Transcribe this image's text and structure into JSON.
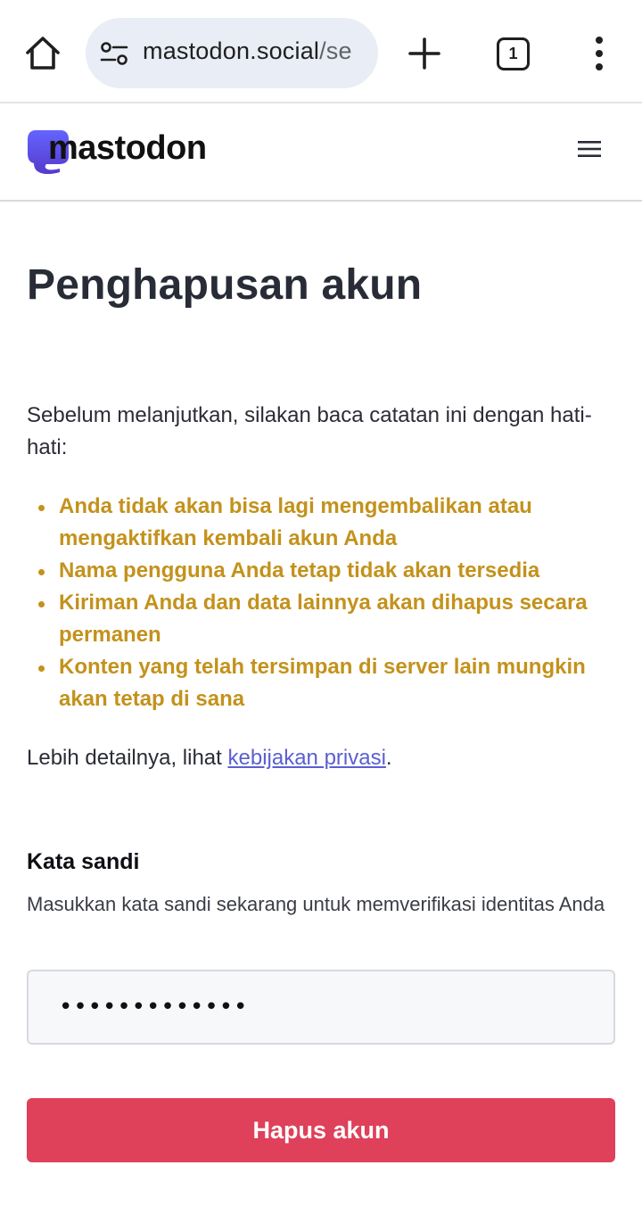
{
  "browser": {
    "url_main": "mastodon.social",
    "url_rest": "/se",
    "tab_count": "1",
    "icons": {
      "home": "home-icon",
      "site_settings": "tune-icon",
      "new_tab": "plus-icon",
      "menu": "more-vert-icon"
    }
  },
  "site": {
    "brand": "mastodon",
    "brand_color": "#6364FF",
    "menu_icon": "hamburger-icon"
  },
  "page": {
    "title": "Penghapusan akun",
    "intro": "Sebelum melanjutkan, silakan baca catatan ini dengan hati-hati:",
    "warnings": [
      "Anda tidak akan bisa lagi mengembalikan atau mengaktifkan kembali akun Anda",
      "Nama pengguna Anda tetap tidak akan tersedia",
      "Kiriman Anda dan data lainnya akan dihapus secara permanen",
      "Konten yang telah tersimpan di server lain mungkin akan tetap di sana"
    ],
    "details_prefix": "Lebih detailnya, lihat ",
    "details_link": "kebijakan privasi",
    "details_suffix": ".",
    "warning_color": "#c3921c",
    "link_color": "#5b5fd0"
  },
  "form": {
    "password_label": "Kata sandi",
    "password_hint": "Masukkan kata sandi sekarang untuk memverifikasi identitas Anda",
    "password_value": "•••••••••••••",
    "submit_label": "Hapus akun",
    "submit_color": "#df405a"
  }
}
